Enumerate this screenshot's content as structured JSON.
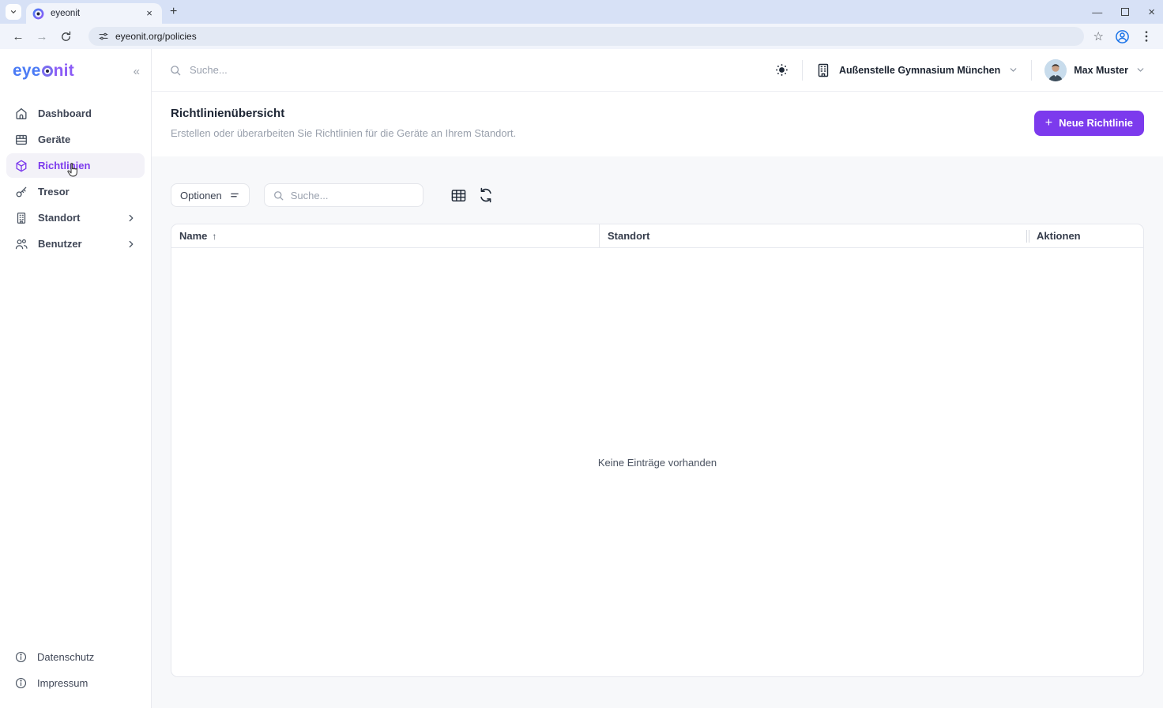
{
  "browser": {
    "tab_title": "eyeonit",
    "url": "eyeonit.org/policies"
  },
  "sidebar": {
    "logo_pre": "eye",
    "logo_post": "nit",
    "items": [
      {
        "label": "Dashboard"
      },
      {
        "label": "Geräte"
      },
      {
        "label": "Richtlinien"
      },
      {
        "label": "Tresor"
      },
      {
        "label": "Standort"
      },
      {
        "label": "Benutzer"
      }
    ],
    "footer_items": [
      {
        "label": "Datenschutz"
      },
      {
        "label": "Impressum"
      }
    ]
  },
  "header": {
    "search_placeholder": "Suche...",
    "org_name": "Außenstelle Gymnasium München",
    "user_name": "Max Muster"
  },
  "page": {
    "title": "Richtlinienübersicht",
    "subtitle": "Erstellen oder überarbeiten Sie Richtlinien für die Geräte an Ihrem Standort.",
    "new_button_label": "Neue Richtlinie"
  },
  "toolbar": {
    "options_label": "Optionen",
    "search_placeholder": "Suche..."
  },
  "table": {
    "columns": [
      "Name",
      "Standort",
      "Aktionen"
    ],
    "empty_text": "Keine Einträge vorhanden"
  },
  "colors": {
    "accent_purple": "#7c3aed",
    "logo_blue": "#4b7bf5",
    "logo_purple": "#8b5cf6"
  }
}
